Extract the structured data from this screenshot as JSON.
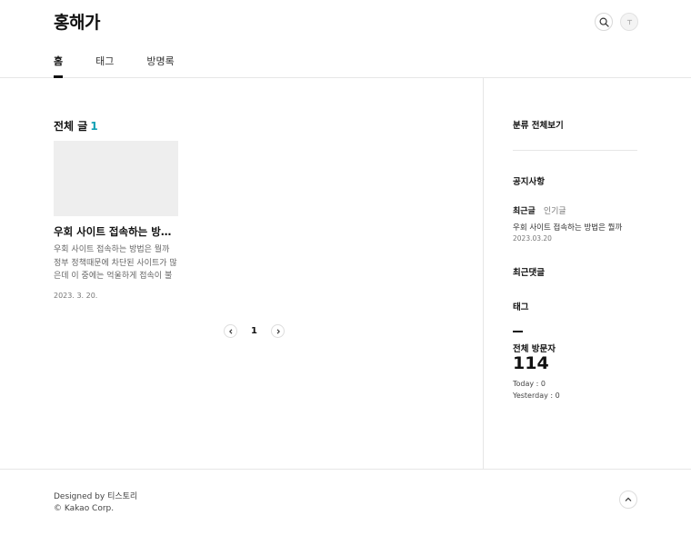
{
  "header": {
    "blog_title": "홍해가",
    "nav": [
      {
        "label": "홈",
        "active": true
      },
      {
        "label": "태그",
        "active": false
      },
      {
        "label": "방명록",
        "active": false
      }
    ],
    "search_icon": "search-icon",
    "profile_icon": "profile-icon"
  },
  "main": {
    "list_title": "전체 글",
    "list_count": "1",
    "posts": [
      {
        "title": "우회 사이트 접속하는 방법은 뭘까",
        "summary": "우회 사이트 접속하는 방법은 뭘까 정부 정책때문에 차단된 사이트가 많은데 이 중에는 억울하게 접속이 불가한 사이트도 있습니다",
        "date": "2023. 3. 20."
      }
    ],
    "pagination": {
      "current": "1"
    }
  },
  "sidebar": {
    "category_all": "분류 전체보기",
    "notice": "공지사항",
    "tab_recent": "최근글",
    "tab_popular": "인기글",
    "recent_post_title": "우회 사이트 접속하는 방법은 뭘까",
    "recent_post_date": "2023.03.20",
    "recent_comments": "최근댓글",
    "tags": "태그",
    "visitors_label": "전체 방문자",
    "visitors_total": "114",
    "today_label": "Today",
    "today_value": "0",
    "yesterday_label": "Yesterday",
    "yesterday_value": "0"
  },
  "footer": {
    "designed_by": "Designed by 티스토리",
    "copyright": "© Kakao Corp."
  },
  "colors": {
    "accent": "#11a0b4",
    "text": "#111111",
    "border": "#e6e6e6",
    "thumbnail": "#eeeeee"
  }
}
